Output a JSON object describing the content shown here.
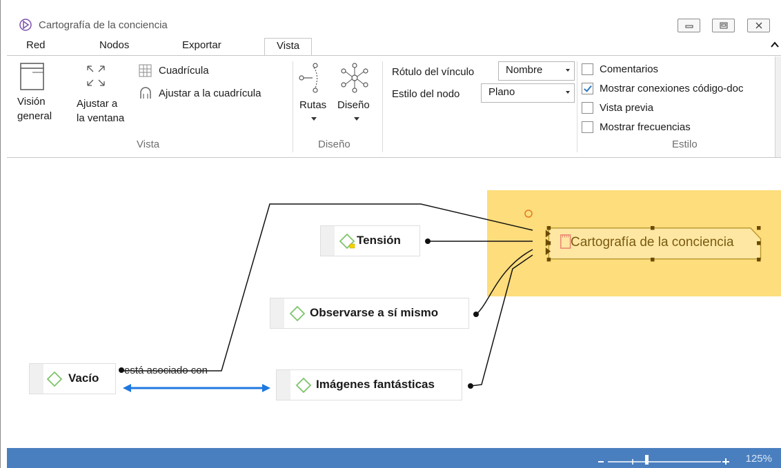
{
  "window": {
    "title": "Cartografía de la conciencia"
  },
  "tabs": [
    {
      "label": "Red"
    },
    {
      "label": "Nodos"
    },
    {
      "label": "Exportar"
    },
    {
      "label": "Vista",
      "active": true
    }
  ],
  "ribbon": {
    "vista_group": {
      "label": "Vista",
      "vision_general": [
        "Visión",
        "general"
      ],
      "ajustar_ventana": [
        "Ajustar a",
        "la ventana"
      ],
      "cuadricula": "Cuadrícula",
      "ajustar_cuadricula": "Ajustar a la cuadrícula"
    },
    "diseno_group": {
      "label": "Diseño",
      "rutas": "Rutas",
      "diseno": "Diseño"
    },
    "estilo_group": {
      "label": "Estilo",
      "rotulo_label": "Rótulo del vínculo",
      "rotulo_value": "Nombre",
      "estilo_nodo_label": "Estilo del nodo",
      "estilo_nodo_value": "Plano",
      "checkboxes": [
        {
          "label": "Comentarios",
          "checked": false
        },
        {
          "label": "Mostrar conexiones código-doc",
          "checked": true
        },
        {
          "label": "Vista previa",
          "checked": false
        },
        {
          "label": "Mostrar frecuencias",
          "checked": false
        }
      ]
    }
  },
  "network": {
    "nodes": [
      {
        "name": "Tensión",
        "type": "code",
        "has_comment": true
      },
      {
        "name": "Observarse a sí mismo",
        "type": "code"
      },
      {
        "name": "Vacío",
        "type": "code"
      },
      {
        "name": "Imágenes fantásticas",
        "type": "code"
      },
      {
        "name": "Cartografía de la conciencia",
        "type": "document",
        "selected": true
      }
    ],
    "link_label": "está asociado con"
  },
  "status": {
    "zoom": "125%"
  },
  "colors": {
    "code_icon": "#7cc46a",
    "selection": "#fddd7c",
    "link_arrow": "#1f78e0",
    "status_bar": "#4a7fbf",
    "document_icon": "#e87a6a"
  }
}
